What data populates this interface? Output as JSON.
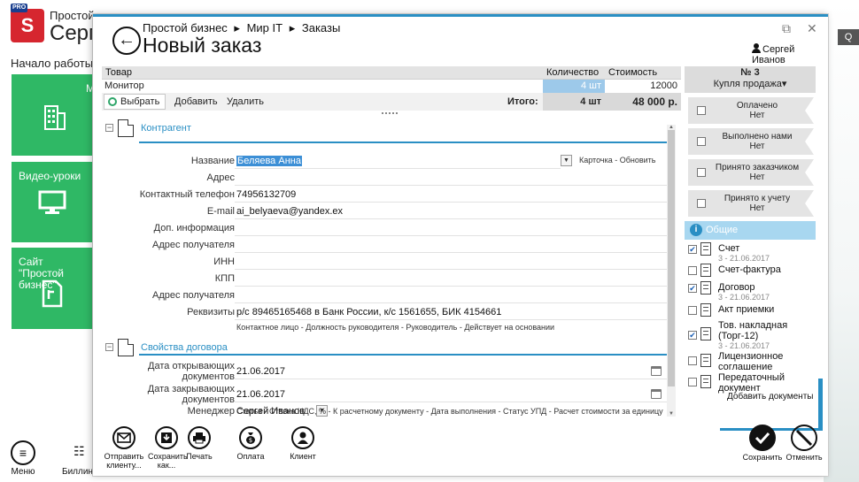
{
  "background": {
    "logo_top": "PRO",
    "logo_letter": "S",
    "app_title_line1": "Простой",
    "app_title_line2": "Серг",
    "start_label": "Начало работы",
    "tile1_label": "М",
    "tile2_label": "Видео-уроки",
    "tile3_label": "Сайт \"Простой бизнес\"",
    "search_label": "Q",
    "menu_label": "Меню",
    "billing_label": "Биллинг"
  },
  "dialog": {
    "breadcrumb": [
      "Простой бизнес",
      "Мир IT",
      "Заказы"
    ],
    "breadcrumb_sep": "▸",
    "title": "Новый заказ",
    "user_name": "Сергей Иванов",
    "window_controls": {
      "restore": "⧉",
      "close": "✕"
    }
  },
  "goods": {
    "headers": {
      "item": "Товар",
      "qty": "Количество",
      "cost": "Стоимость"
    },
    "row": {
      "item": "Монитор",
      "qty": "4 шт",
      "cost": "12000"
    },
    "toolbar": {
      "select": "Выбрать",
      "add": "Добавить",
      "delete": "Удалить"
    },
    "total_label": "Итого:",
    "total_qty": "4 шт",
    "total_cost": "48 000 р."
  },
  "counterparty": {
    "section_title": "Контрагент",
    "toggle": "−",
    "fields": {
      "name_label": "Название",
      "name_value": "Беляева Анна",
      "address_label": "Адрес",
      "address_value": "",
      "phone_label": "Контактный телефон",
      "phone_value": "74956132709",
      "email_label": "E-mail",
      "email_value": "ai_belyaeva@yandex.ex",
      "extra_label": "Доп. информация",
      "extra_value": "",
      "recipient_address_label": "Адрес получателя",
      "recipient_address_value": "",
      "inn_label": "ИНН",
      "inn_value": "",
      "kpp_label": "КПП",
      "kpp_value": "",
      "recipient_address2_label": "Адрес получателя",
      "recipient_address2_value": "",
      "requisites_label": "Реквизиты",
      "requisites_value": "р/с 89465165468 в Банк России, к/с 1561655, БИК 4154661"
    },
    "card_link": "Карточка",
    "refresh_link": "Обновить",
    "link_sep": " - ",
    "extra_links": "Контактное лицо - Должность руководителя - Руководитель - Действует на основании"
  },
  "contract": {
    "section_title": "Свойства договора",
    "toggle": "−",
    "open_docs_label_1": "Дата открывающих",
    "open_docs_label_2": "документов",
    "open_docs_value": "21.06.2017",
    "close_docs_label_1": "Дата закрывающих",
    "close_docs_label_2": "документов",
    "close_docs_value": "21.06.2017",
    "manager_label": "Менеджер",
    "manager_value": "Сергей Иванов",
    "extra_links": "Статья - Ставка НДС, % - К расчетному документу - Дата выполнения - Статус УПД - Расчет стоимости за единицу"
  },
  "right_panel": {
    "number": "№ 3",
    "deal_type": "Купля продажа",
    "deal_caret": "▾",
    "statuses": [
      {
        "label": "Оплачено",
        "value": "Нет"
      },
      {
        "label": "Выполнено нами",
        "value": "Нет"
      },
      {
        "label": "Принято заказчиком",
        "value": "Нет"
      },
      {
        "label": "Принято к учету",
        "value": "Нет"
      }
    ],
    "general_label": "Общие",
    "info_glyph": "i",
    "check_glyph": "✔",
    "documents": [
      {
        "name": "Счет",
        "date": "3 - 21.06.2017",
        "checked": true
      },
      {
        "name": "Счет-фактура",
        "date": "",
        "checked": false
      },
      {
        "name": "Договор",
        "date": "3 - 21.06.2017",
        "checked": true
      },
      {
        "name": "Акт приемки",
        "date": "",
        "checked": false
      },
      {
        "name": "Тов. накладная (Торг-12)",
        "date": "3 - 21.06.2017",
        "checked": true
      },
      {
        "name": "Лицензионное соглашение",
        "date": "",
        "checked": false
      },
      {
        "name": "Передаточный документ",
        "date": "",
        "checked": false
      }
    ],
    "add_documents": "Добавить документы"
  },
  "bottom_bar": {
    "send": "Отправить клиенту...",
    "save_as": "Сохранить как...",
    "print": "Печать",
    "payment": "Оплата",
    "client": "Клиент",
    "save": "Сохранить",
    "cancel": "Отменить"
  }
}
